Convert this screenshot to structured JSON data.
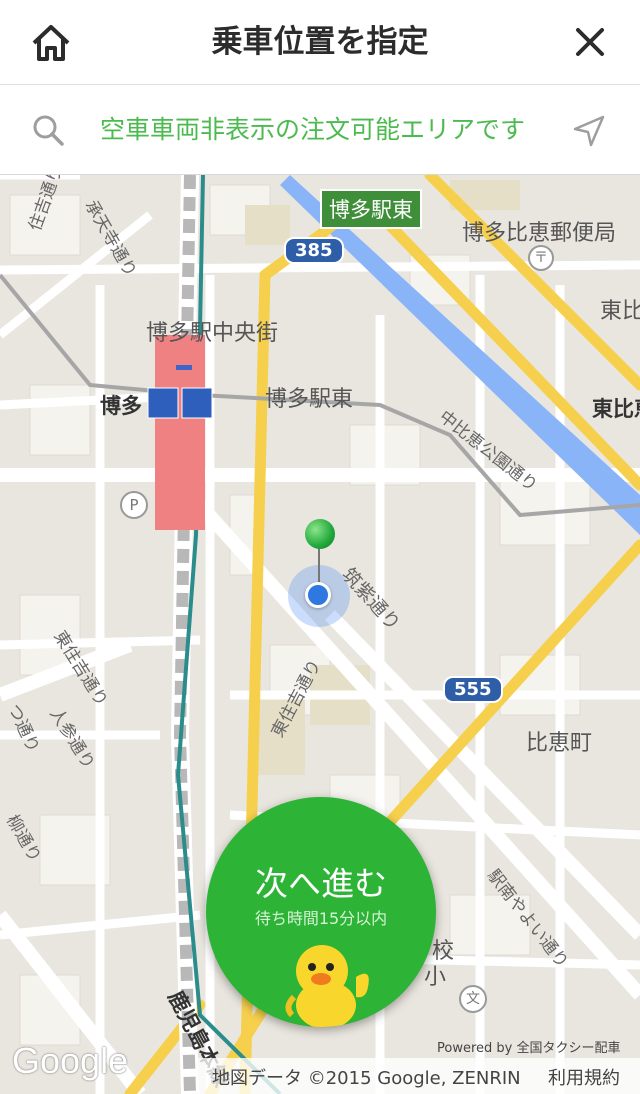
{
  "header": {
    "title": "乗車位置を指定"
  },
  "search": {
    "message": "空車車両非表示の注文可能エリアです"
  },
  "map": {
    "labels": {
      "station_east_badge": "博多駅東",
      "post_office": "博多比恵郵便局",
      "east_hie_1": "東比",
      "east_hie_2": "東比恵",
      "central_street": "博多駅中央街",
      "hakata": "博多",
      "hakata_east": "博多駅東",
      "naka_hie_park_st": "中比恵公園通り",
      "chikushi_st": "筑紫通り",
      "higashi_sumiyoshi": "東住吉通り",
      "higashi_sumiyoshi_2": "東住吉通り",
      "ninjin_st": "人参通り",
      "yanagi_st": "柳通り",
      "hie_cho": "比恵町",
      "ekinan_yayoi": "駅南やよい通り",
      "kagoshima_line": "鹿児島本線",
      "shotenji_st": "承天寺通り",
      "sumiyoshi_st": "住吉通り",
      "school": "校",
      "small": "小",
      "tsu_st": "つ通り",
      "route_385": "385",
      "route_555": "555",
      "parking": "P",
      "school_symbol": "文",
      "post_symbol": "〒"
    }
  },
  "next_button": {
    "label": "次へ進む",
    "wait_time": "待ち時間15分以内"
  },
  "footer": {
    "google": "Google",
    "powered": "Powered by 全国タクシー配車",
    "attribution": "地図データ ©2015 Google, ZENRIN",
    "terms": "利用規約"
  },
  "colors": {
    "accent_green": "#2db335",
    "message_green": "#4cbb4f",
    "pin_blue": "#2f78e0",
    "river_blue": "#8ab4f8",
    "road_yellow": "#f6d04d",
    "station_red": "#ef8183"
  },
  "icons": {
    "home": "home-icon",
    "close": "close-icon",
    "search": "search-icon",
    "locate": "navigation-arrow-icon"
  }
}
